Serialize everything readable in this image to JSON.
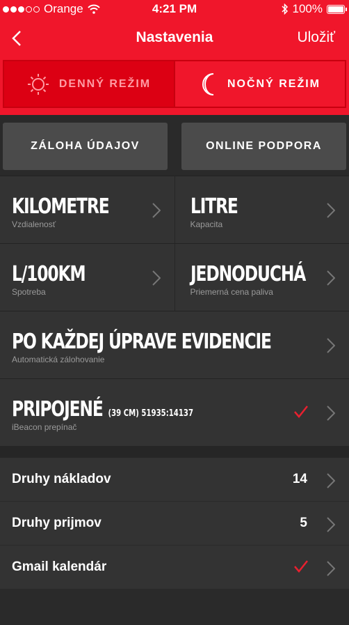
{
  "status_bar": {
    "carrier": "Orange",
    "time": "4:21 PM",
    "battery": "100%"
  },
  "nav": {
    "title": "Nastavenia",
    "save": "Uložiť"
  },
  "mode": {
    "day": "DENNÝ REŽIM",
    "night": "NOČNÝ REŽIM"
  },
  "actions": {
    "backup": "ZÁLOHA ÚDAJOV",
    "support": "ONLINE PODPORA"
  },
  "settings": {
    "distance": {
      "value": "KILOMETRE",
      "label": "Vzdialenosť"
    },
    "capacity": {
      "value": "LITRE",
      "label": "Kapacita"
    },
    "consumption": {
      "value": "L/100KM",
      "label": "Spotreba"
    },
    "fuel_price": {
      "value": "JEDNODUCHÁ",
      "label": "Priemerná cena paliva"
    },
    "auto_backup": {
      "value": "PO KAŽDEJ ÚPRAVE EVIDENCIE",
      "label": "Automatická zálohovanie"
    },
    "ibeacon": {
      "value": "PRIPOJENÉ",
      "detail": "(39 CM) 51935:14137",
      "label": "iBeacon prepínač",
      "checked": true
    }
  },
  "list": [
    {
      "label": "Druhy nákladov",
      "value": "14"
    },
    {
      "label": "Druhy prijmov",
      "value": "5"
    },
    {
      "label": "Gmail kalendár",
      "checked": true
    }
  ],
  "colors": {
    "accent": "#f0162b",
    "check": "#e8202f"
  }
}
